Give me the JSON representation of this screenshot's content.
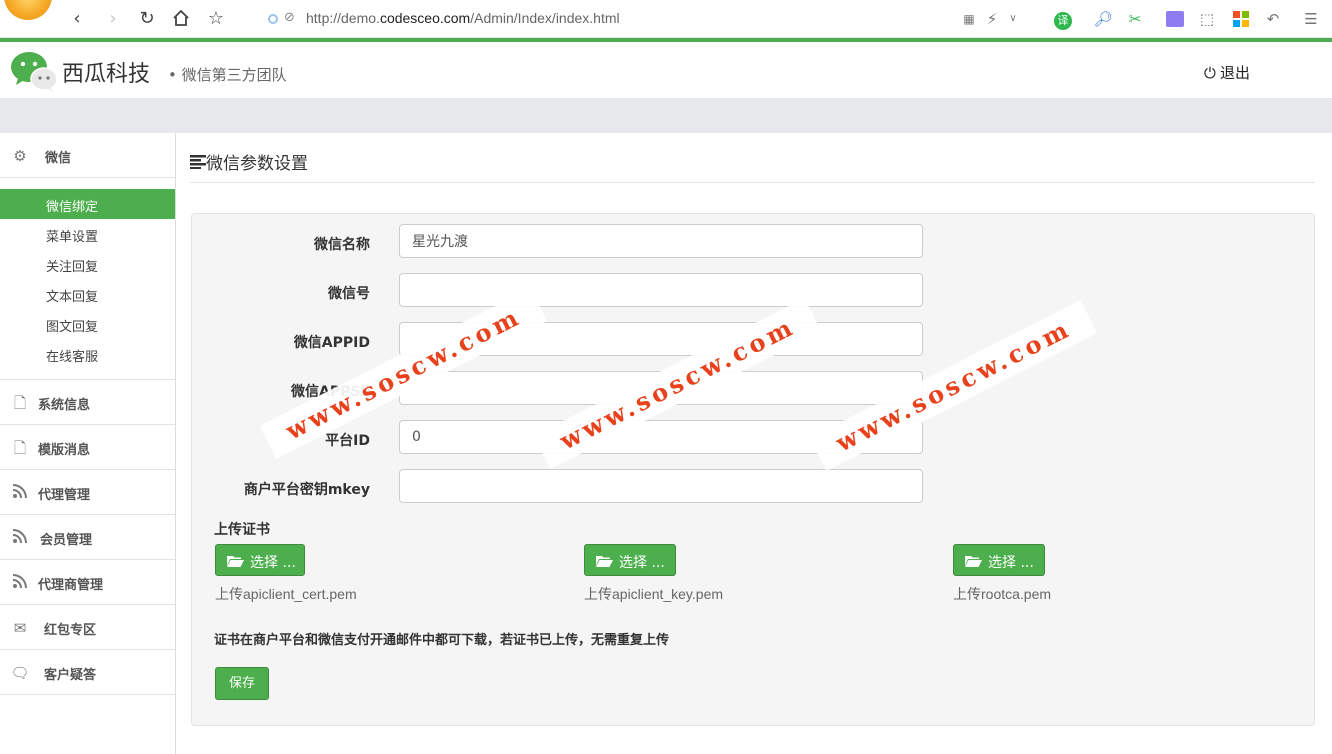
{
  "browser": {
    "url_prefix": "http://demo.",
    "url_domain": "codesceo.com",
    "url_path": "/Admin/Index/index.html",
    "translate_label": "译"
  },
  "header": {
    "brand": "西瓜科技",
    "subtitle": "• 微信第三方团队",
    "logout": "退出"
  },
  "sidebar": {
    "groups": [
      {
        "label": "微信",
        "icon": "gears-icon"
      },
      {
        "label": "系统信息",
        "icon": "file-icon"
      },
      {
        "label": "模版消息",
        "icon": "file-icon"
      },
      {
        "label": "代理管理",
        "icon": "rss-icon"
      },
      {
        "label": "会员管理",
        "icon": "rss-icon"
      },
      {
        "label": "代理商管理",
        "icon": "rss-icon"
      },
      {
        "label": "红包专区",
        "icon": "envelope-icon"
      },
      {
        "label": "客户疑答",
        "icon": "comments-icon"
      }
    ],
    "sub_items": [
      {
        "label": "微信绑定",
        "active": true
      },
      {
        "label": "菜单设置"
      },
      {
        "label": "关注回复"
      },
      {
        "label": "文本回复"
      },
      {
        "label": "图文回复"
      },
      {
        "label": "在线客服"
      }
    ]
  },
  "main": {
    "title": "微信参数设置",
    "fields": [
      {
        "label": "微信名称",
        "value": "星光九渡"
      },
      {
        "label": "微信号",
        "value": ""
      },
      {
        "label": "微信APPID",
        "value": ""
      },
      {
        "label": "微信APPSE",
        "value": ""
      },
      {
        "label": "平台ID",
        "value": "0"
      },
      {
        "label": "商户平台密钥mkey",
        "value": ""
      }
    ],
    "upload_title": "上传证书",
    "upload_button": "选择 ...",
    "uploads": [
      "上传apiclient_cert.pem",
      "上传apiclient_key.pem",
      "上传rootca.pem"
    ],
    "note": "证书在商户平台和微信支付开通邮件中都可下载，若证书已上传，无需重复上传",
    "save": "保存"
  },
  "watermark": "www.soscw.com",
  "colors": {
    "accent": "#4cae4c",
    "watermark": "#e8411b",
    "strip": "#e7e8ec"
  }
}
